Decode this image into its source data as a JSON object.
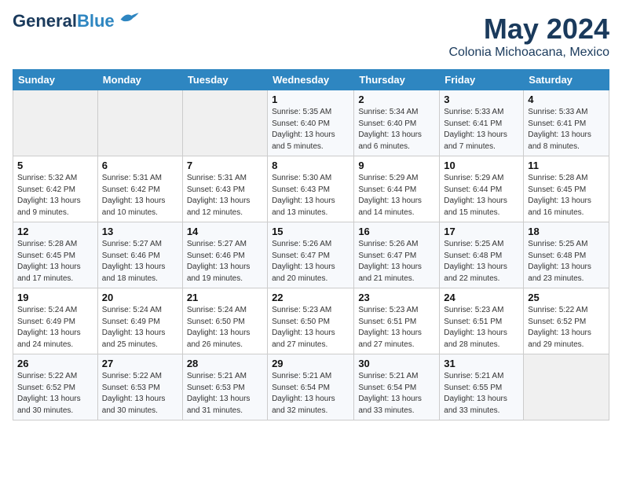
{
  "header": {
    "logo_line1": "General",
    "logo_line2": "Blue",
    "main_title": "May 2024",
    "subtitle": "Colonia Michoacana, Mexico"
  },
  "weekdays": [
    "Sunday",
    "Monday",
    "Tuesday",
    "Wednesday",
    "Thursday",
    "Friday",
    "Saturday"
  ],
  "weeks": [
    [
      {
        "day": "",
        "info": ""
      },
      {
        "day": "",
        "info": ""
      },
      {
        "day": "",
        "info": ""
      },
      {
        "day": "1",
        "info": "Sunrise: 5:35 AM\nSunset: 6:40 PM\nDaylight: 13 hours\nand 5 minutes."
      },
      {
        "day": "2",
        "info": "Sunrise: 5:34 AM\nSunset: 6:40 PM\nDaylight: 13 hours\nand 6 minutes."
      },
      {
        "day": "3",
        "info": "Sunrise: 5:33 AM\nSunset: 6:41 PM\nDaylight: 13 hours\nand 7 minutes."
      },
      {
        "day": "4",
        "info": "Sunrise: 5:33 AM\nSunset: 6:41 PM\nDaylight: 13 hours\nand 8 minutes."
      }
    ],
    [
      {
        "day": "5",
        "info": "Sunrise: 5:32 AM\nSunset: 6:42 PM\nDaylight: 13 hours\nand 9 minutes."
      },
      {
        "day": "6",
        "info": "Sunrise: 5:31 AM\nSunset: 6:42 PM\nDaylight: 13 hours\nand 10 minutes."
      },
      {
        "day": "7",
        "info": "Sunrise: 5:31 AM\nSunset: 6:43 PM\nDaylight: 13 hours\nand 12 minutes."
      },
      {
        "day": "8",
        "info": "Sunrise: 5:30 AM\nSunset: 6:43 PM\nDaylight: 13 hours\nand 13 minutes."
      },
      {
        "day": "9",
        "info": "Sunrise: 5:29 AM\nSunset: 6:44 PM\nDaylight: 13 hours\nand 14 minutes."
      },
      {
        "day": "10",
        "info": "Sunrise: 5:29 AM\nSunset: 6:44 PM\nDaylight: 13 hours\nand 15 minutes."
      },
      {
        "day": "11",
        "info": "Sunrise: 5:28 AM\nSunset: 6:45 PM\nDaylight: 13 hours\nand 16 minutes."
      }
    ],
    [
      {
        "day": "12",
        "info": "Sunrise: 5:28 AM\nSunset: 6:45 PM\nDaylight: 13 hours\nand 17 minutes."
      },
      {
        "day": "13",
        "info": "Sunrise: 5:27 AM\nSunset: 6:46 PM\nDaylight: 13 hours\nand 18 minutes."
      },
      {
        "day": "14",
        "info": "Sunrise: 5:27 AM\nSunset: 6:46 PM\nDaylight: 13 hours\nand 19 minutes."
      },
      {
        "day": "15",
        "info": "Sunrise: 5:26 AM\nSunset: 6:47 PM\nDaylight: 13 hours\nand 20 minutes."
      },
      {
        "day": "16",
        "info": "Sunrise: 5:26 AM\nSunset: 6:47 PM\nDaylight: 13 hours\nand 21 minutes."
      },
      {
        "day": "17",
        "info": "Sunrise: 5:25 AM\nSunset: 6:48 PM\nDaylight: 13 hours\nand 22 minutes."
      },
      {
        "day": "18",
        "info": "Sunrise: 5:25 AM\nSunset: 6:48 PM\nDaylight: 13 hours\nand 23 minutes."
      }
    ],
    [
      {
        "day": "19",
        "info": "Sunrise: 5:24 AM\nSunset: 6:49 PM\nDaylight: 13 hours\nand 24 minutes."
      },
      {
        "day": "20",
        "info": "Sunrise: 5:24 AM\nSunset: 6:49 PM\nDaylight: 13 hours\nand 25 minutes."
      },
      {
        "day": "21",
        "info": "Sunrise: 5:24 AM\nSunset: 6:50 PM\nDaylight: 13 hours\nand 26 minutes."
      },
      {
        "day": "22",
        "info": "Sunrise: 5:23 AM\nSunset: 6:50 PM\nDaylight: 13 hours\nand 27 minutes."
      },
      {
        "day": "23",
        "info": "Sunrise: 5:23 AM\nSunset: 6:51 PM\nDaylight: 13 hours\nand 27 minutes."
      },
      {
        "day": "24",
        "info": "Sunrise: 5:23 AM\nSunset: 6:51 PM\nDaylight: 13 hours\nand 28 minutes."
      },
      {
        "day": "25",
        "info": "Sunrise: 5:22 AM\nSunset: 6:52 PM\nDaylight: 13 hours\nand 29 minutes."
      }
    ],
    [
      {
        "day": "26",
        "info": "Sunrise: 5:22 AM\nSunset: 6:52 PM\nDaylight: 13 hours\nand 30 minutes."
      },
      {
        "day": "27",
        "info": "Sunrise: 5:22 AM\nSunset: 6:53 PM\nDaylight: 13 hours\nand 30 minutes."
      },
      {
        "day": "28",
        "info": "Sunrise: 5:21 AM\nSunset: 6:53 PM\nDaylight: 13 hours\nand 31 minutes."
      },
      {
        "day": "29",
        "info": "Sunrise: 5:21 AM\nSunset: 6:54 PM\nDaylight: 13 hours\nand 32 minutes."
      },
      {
        "day": "30",
        "info": "Sunrise: 5:21 AM\nSunset: 6:54 PM\nDaylight: 13 hours\nand 33 minutes."
      },
      {
        "day": "31",
        "info": "Sunrise: 5:21 AM\nSunset: 6:55 PM\nDaylight: 13 hours\nand 33 minutes."
      },
      {
        "day": "",
        "info": ""
      }
    ]
  ]
}
